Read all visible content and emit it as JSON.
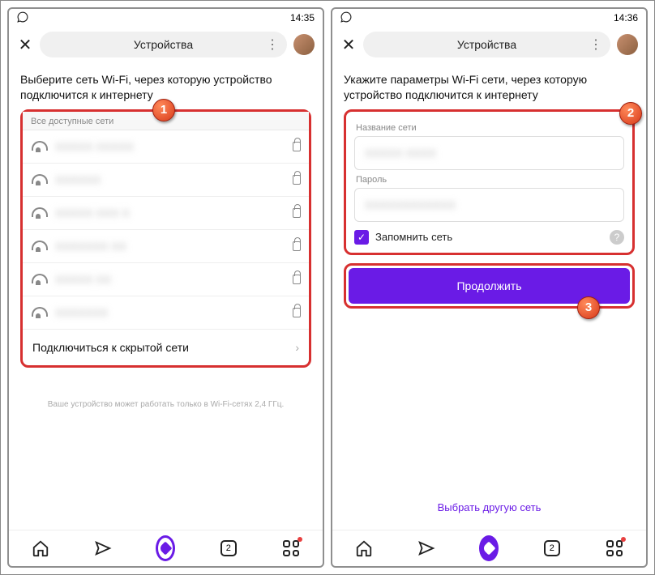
{
  "left": {
    "status_time": "14:35",
    "header_title": "Устройства",
    "title": "Выберите сеть Wi-Fi, через которую устройство подключится к интернету",
    "subheader": "Все доступные сети",
    "networks": [
      {
        "ssid": "XXXXX XXXXX"
      },
      {
        "ssid": "XXXXXX"
      },
      {
        "ssid": "XXXXX XXX X"
      },
      {
        "ssid": "XXXXXXX XX"
      },
      {
        "ssid": "XXXXX XX"
      },
      {
        "ssid": "XXXXXXX"
      }
    ],
    "hidden_link": "Подключиться к скрытой сети",
    "footnote": "Ваше устройство может работать только в Wi-Fi-сетях 2,4 ГГц.",
    "nav_count": "2",
    "marker": "1"
  },
  "right": {
    "status_time": "14:36",
    "header_title": "Устройства",
    "title": "Укажите параметры Wi-Fi сети, через которую устройство подключится к интернету",
    "ssid_label": "Название сети",
    "ssid_value": "XXXXX XXXX",
    "pwd_label": "Пароль",
    "pwd_value": "XXXXXXXXXXXX",
    "remember": "Запомнить сеть",
    "continue": "Продолжить",
    "other_link": "Выбрать другую сеть",
    "nav_count": "2",
    "marker2": "2",
    "marker3": "3"
  }
}
